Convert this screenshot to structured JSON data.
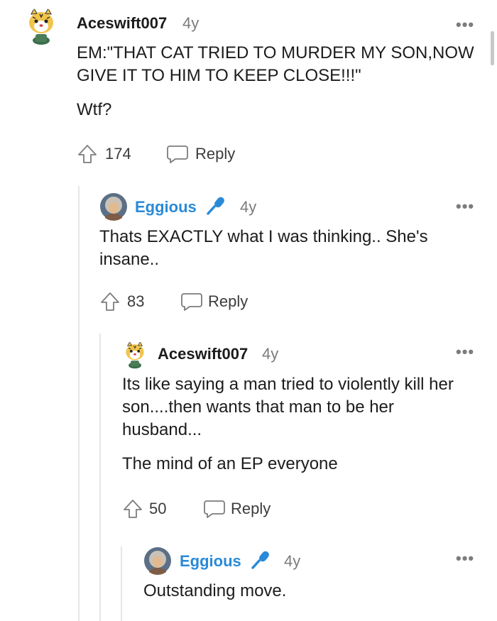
{
  "comments": [
    {
      "username": "Aceswift007",
      "age": "4y",
      "avatar": "tiger-avatar-icon",
      "paragraphs": [
        "EM:\"THAT CAT TRIED TO MURDER MY SON,NOW GIVE IT TO HIM TO KEEP CLOSE!!!\"",
        "Wtf?"
      ],
      "votes": "174",
      "reply_label": "Reply"
    },
    {
      "username": "Eggious",
      "age": "4y",
      "avatar": "eggious-avatar-icon",
      "badge": "microphone-icon",
      "paragraphs": [
        "Thats EXACTLY what I was thinking.. She's insane.."
      ],
      "votes": "83",
      "reply_label": "Reply"
    },
    {
      "username": "Aceswift007",
      "age": "4y",
      "avatar": "tiger-avatar-icon",
      "paragraphs": [
        "Its like saying a man tried to violently kill her son....then wants that man to be her husband...",
        "The mind of an EP everyone"
      ],
      "votes": "50",
      "reply_label": "Reply"
    },
    {
      "username": "Eggious",
      "age": "4y",
      "avatar": "eggious-avatar-icon",
      "badge": "microphone-icon",
      "paragraphs": [
        "Outstanding move."
      ]
    }
  ],
  "more_symbol": "•••",
  "colors": {
    "mod_blue": "#2a8ad8",
    "meta_gray": "#7c7c7c",
    "thread_line": "#e6e6e6"
  }
}
